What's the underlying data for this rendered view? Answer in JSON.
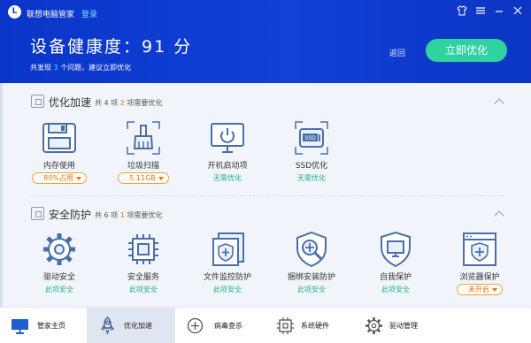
{
  "header": {
    "app_name": "联想电脑管家",
    "login_label": "登录",
    "health_label": "设备健康度：",
    "health_score": "91 分",
    "issues_prefix": "共发现",
    "issues_count": "3",
    "issues_suffix": "个问题，建议立即优化",
    "back_label": "返回",
    "optimize_label": "立即优化",
    "window_controls": [
      "shirt-icon",
      "menu-icon",
      "minimize-icon",
      "close-icon"
    ]
  },
  "sections": {
    "speedup": {
      "title": "优化加速",
      "summary_prefix": "共 4 项",
      "summary_count": "2",
      "summary_suffix": "项需要优化",
      "items": [
        {
          "icon": "floppy-disk-icon",
          "label": "内存使用",
          "value": "80%占用"
        },
        {
          "icon": "broom-icon",
          "label": "垃圾扫描",
          "value": "5.11GB"
        },
        {
          "icon": "monitor-power-icon",
          "label": "开机启动项",
          "status": "无需优化"
        },
        {
          "icon": "ssd-icon",
          "label": "SSD优化",
          "status": "无需优化"
        }
      ]
    },
    "security": {
      "title": "安全防护",
      "summary_prefix": "共 6 项",
      "summary_count": "1",
      "summary_suffix": "项需要优化",
      "items": [
        {
          "icon": "gear-icon",
          "label": "驱动安全",
          "status": "此项安全"
        },
        {
          "icon": "chip-icon",
          "label": "安全服务",
          "status": "此项安全"
        },
        {
          "icon": "shield-stack-icon",
          "label": "文件监控防护",
          "status": "此项安全"
        },
        {
          "icon": "shield-search-icon",
          "label": "捆绑安装防护",
          "status": "此项安全"
        },
        {
          "icon": "monitor-shield-icon",
          "label": "自我保护",
          "status": "此项安全"
        },
        {
          "icon": "browser-shield-icon",
          "label": "浏览器保护",
          "value": "未开启"
        }
      ]
    }
  },
  "footer": {
    "tabs": [
      {
        "icon": "monitor-icon",
        "label": "管家主页"
      },
      {
        "icon": "rocket-icon",
        "label": "优化加速",
        "active": true
      },
      {
        "icon": "virus-scan-icon",
        "label": "病毒查杀"
      },
      {
        "icon": "hardware-icon",
        "label": "系统硬件"
      },
      {
        "icon": "driver-gear-icon",
        "label": "驱动管理"
      }
    ]
  },
  "colors": {
    "header_blue": "#1240d8",
    "accent_green": "#2ed3a0",
    "warning_orange": "#e8740b",
    "safe_green": "#1fb47a"
  }
}
